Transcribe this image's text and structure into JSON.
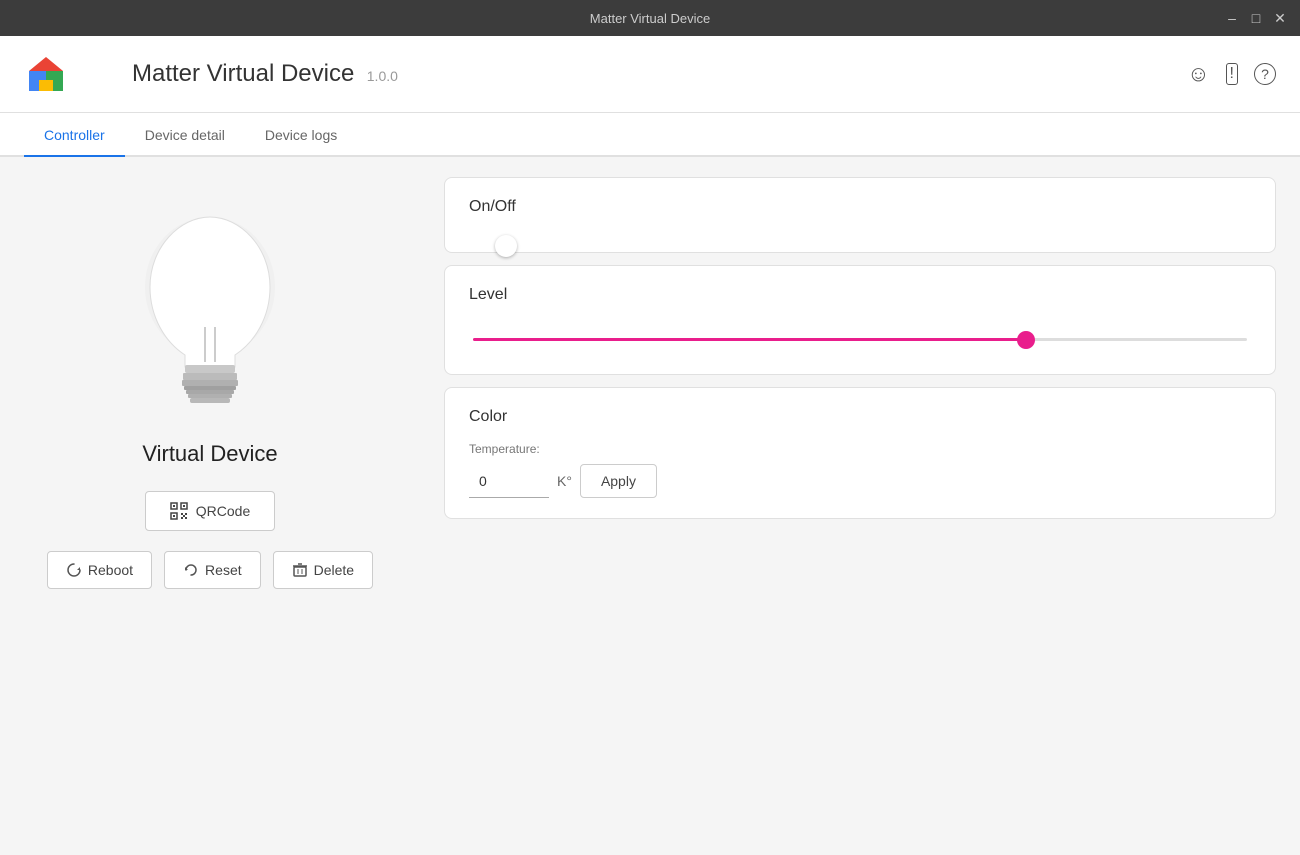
{
  "titlebar": {
    "title": "Matter Virtual Device",
    "minimize_label": "–",
    "restore_label": "□",
    "close_label": "✕"
  },
  "header": {
    "app_title": "Matter Virtual Device",
    "app_version": "1.0.0",
    "emoji_icon": "😊",
    "alert_icon": "⊡",
    "help_icon": "?"
  },
  "tabs": [
    {
      "id": "controller",
      "label": "Controller",
      "active": true
    },
    {
      "id": "device-detail",
      "label": "Device detail",
      "active": false
    },
    {
      "id": "device-logs",
      "label": "Device logs",
      "active": false
    }
  ],
  "left_panel": {
    "device_name": "Virtual Device",
    "qrcode_button": "QRCode",
    "reboot_button": "Reboot",
    "reset_button": "Reset",
    "delete_button": "Delete"
  },
  "controls": {
    "on_off": {
      "label": "On/Off",
      "value": true
    },
    "level": {
      "label": "Level",
      "value": 72
    },
    "color": {
      "label": "Color",
      "temperature_label": "Temperature:",
      "temperature_value": "0",
      "temperature_unit": "K°",
      "apply_label": "Apply"
    }
  }
}
